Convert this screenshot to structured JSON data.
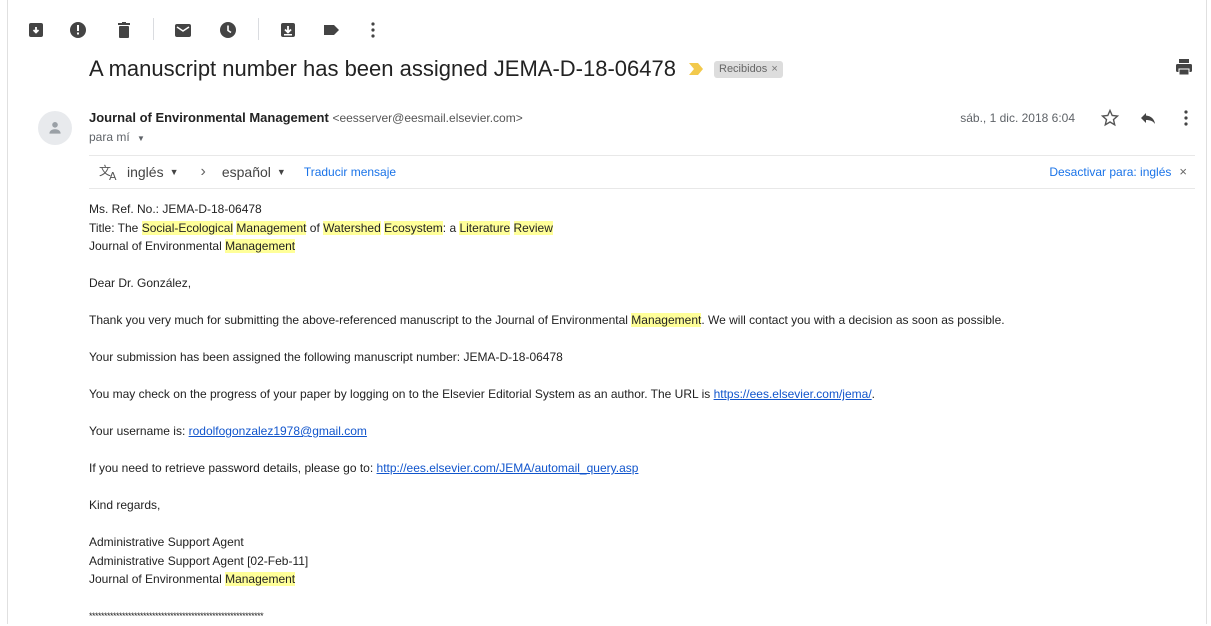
{
  "toolbar": {
    "icons": [
      "archive-icon",
      "report-spam-icon",
      "delete-icon",
      "mark-unread-icon",
      "snooze-icon",
      "move-to-icon",
      "label-icon",
      "more-vert-icon"
    ]
  },
  "subject": {
    "text": "A manuscript number has been assigned JEMA-D-18-06478",
    "label": "Recibidos",
    "label_close": "×",
    "important_color": "#f2c94c"
  },
  "header": {
    "sender_name": "Journal of Environmental Management",
    "sender_email": "<eesserver@eesmail.elsevier.com>",
    "to": "para mí",
    "date": "sáb., 1 dic. 2018 6:04"
  },
  "translate": {
    "from_lang": "inglés",
    "arrow": "›",
    "to_lang": "español",
    "translate_link": "Traducir mensaje",
    "deactivate": "Desactivar para: inglés",
    "close": "×"
  },
  "body": {
    "ref_line": "Ms. Ref. No.:  JEMA-D-18-06478",
    "title_prefix": "Title: The ",
    "title_h1": "Social-Ecological",
    "title_s1": " ",
    "title_h2": "Management",
    "title_s2": " of ",
    "title_h3": "Watershed",
    "title_s3": " ",
    "title_h4": "Ecosystem",
    "title_s4": ": a ",
    "title_h5": "Literature",
    "title_s5": " ",
    "title_h6": "Review",
    "journal_prefix": "Journal of Environmental ",
    "journal_hl": "Management",
    "greeting": "Dear Dr. González,",
    "thanks_prefix": "Thank you very much for submitting the above-referenced manuscript to the Journal of Environmental ",
    "thanks_hl": "Management",
    "thanks_suffix": ". We will contact you with a decision as soon as possible.",
    "assigned": "Your submission has been assigned the following manuscript number: JEMA-D-18-06478",
    "progress_prefix": "You may check on the progress of your paper by logging on to the Elsevier Editorial System as an author. The URL is ",
    "progress_link": "https://ees.elsevier.com/jema/",
    "progress_suffix": ".",
    "username_prefix": "Your username is: ",
    "username_link": "rodolfogonzalez1978@gmail.com",
    "password_prefix": "If you need to retrieve password details, please go to: ",
    "password_link": "http://ees.elsevier.com/JEMA/automail_query.asp",
    "regards": "Kind regards,",
    "sig1": "Administrative Support Agent",
    "sig2": "Administrative Support Agent [02-Feb-11]",
    "sig3_prefix": "Journal of Environmental ",
    "sig3_hl": "Management",
    "stars": "**********************************************************"
  }
}
